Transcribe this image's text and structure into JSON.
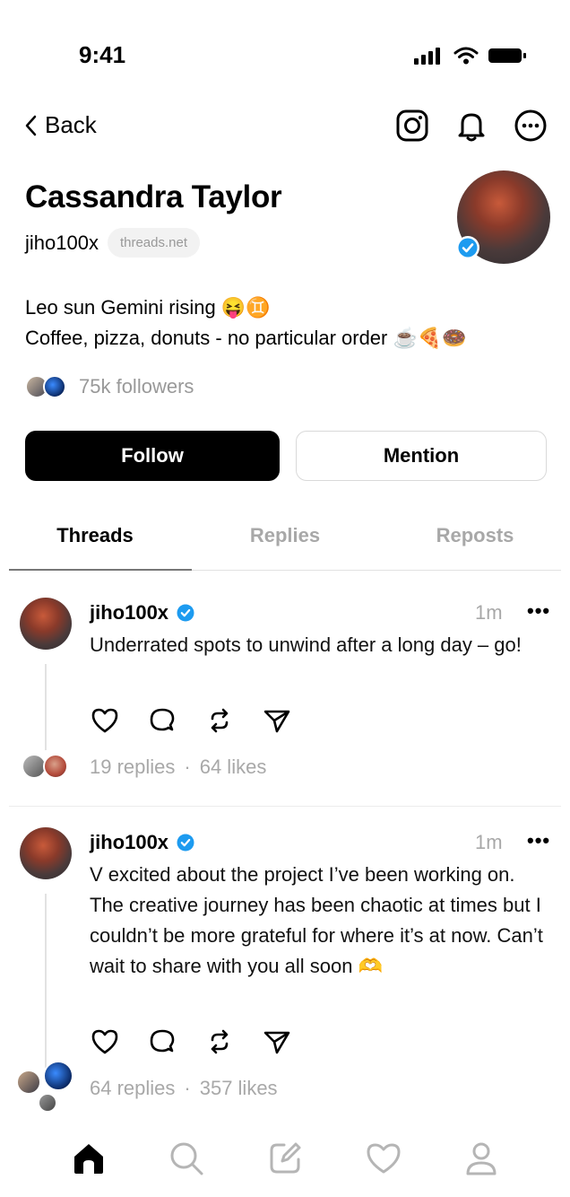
{
  "status": {
    "time": "9:41"
  },
  "nav": {
    "back_label": "Back"
  },
  "profile": {
    "name": "Cassandra Taylor",
    "handle": "jiho100x",
    "domain": "threads.net",
    "bio_line1": "Leo sun Gemini rising 😝♊",
    "bio_line2": "Coffee, pizza, donuts - no particular order ☕🍕🍩",
    "followers": "75k followers"
  },
  "buttons": {
    "follow": "Follow",
    "mention": "Mention"
  },
  "tabs": [
    {
      "label": "Threads"
    },
    {
      "label": "Replies"
    },
    {
      "label": "Reposts"
    }
  ],
  "posts": [
    {
      "username": "jiho100x",
      "time": "1m",
      "more": "•••",
      "text": "Underrated spots to unwind after a long day – go!",
      "replies": "19 replies",
      "sep": "·",
      "likes": "64 likes"
    },
    {
      "username": "jiho100x",
      "time": "1m",
      "more": "•••",
      "text": "V excited about the project I’ve been working on. The creative journey has been chaotic at times but I couldn’t be more grateful for where it’s at now. Can’t wait to share with you all soon 🫶",
      "replies": "64 replies",
      "sep": "·",
      "likes": "357 likes"
    }
  ],
  "tabbar": [
    "home-icon",
    "search-icon",
    "compose-icon",
    "activity-heart-icon",
    "profile-icon"
  ]
}
